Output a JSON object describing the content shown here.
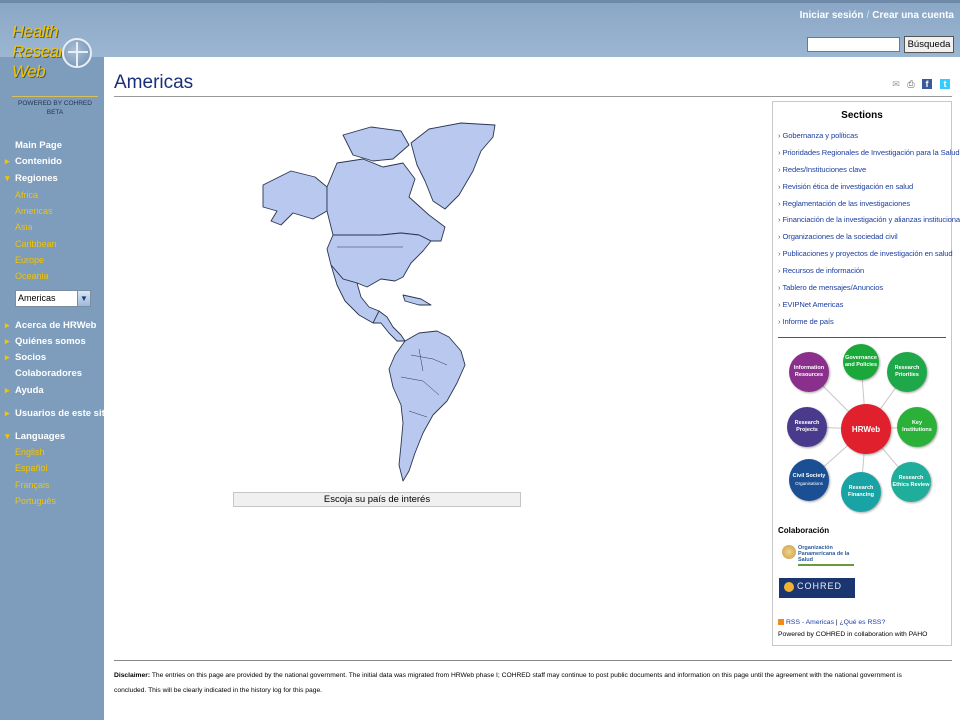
{
  "header": {
    "login_label": "Iniciar sesión",
    "separator": "/",
    "create_account_label": "Crear una cuenta",
    "search": {
      "placeholder": "",
      "button_label": "Búsqueda"
    }
  },
  "logo": {
    "line1": "Health",
    "line2": "Research",
    "line3": "Web",
    "powered": "POWERED BY COHRED",
    "beta": "BETA"
  },
  "sidebar": {
    "main_page": "Main Page",
    "contenido": "Contenido",
    "regiones": "Regiones",
    "regions": [
      "Africa",
      "Americas",
      "Asia",
      "Caribbean",
      "Europe",
      "Oceania"
    ],
    "region_select_value": "Americas",
    "acerca": "Acerca de HRWeb",
    "quienes": "Quiénes somos",
    "socios": "Socios",
    "colaboradores": "Colaboradores",
    "ayuda": "Ayuda",
    "usuarios": "Usuarios de este sitio",
    "languages_label": "Languages",
    "languages": [
      "English",
      "Español",
      "Français",
      "Português"
    ]
  },
  "main": {
    "title": "Americas",
    "country_select_label": "Escoja su país de interés"
  },
  "icons": [
    "email-icon",
    "print-icon",
    "facebook-icon",
    "twitter-icon"
  ],
  "sections": {
    "title": "Sections",
    "items": [
      "Gobernanza y políticas",
      "Prioridades Regionales de Investigación para la Salud",
      "Redes/Instituciones clave",
      "Revisión ética de investigación en salud",
      "Reglamentación de las investigaciones",
      "Financiación de la investigación y alianzas institucionales",
      "Organizaciones de la sociedad civil",
      "Publicaciones y proyectos de investigación en salud",
      "Recursos de información",
      "Tablero de mensajes/Anuncios",
      "EVIPNet Americas",
      "Informe de país"
    ]
  },
  "diagram": {
    "center": "HRWeb",
    "information_resources": "Information Resources",
    "governance": "Governance and Policies",
    "research_priorities": "Research Priorities",
    "research_projects": "Research Projects",
    "key_institutions": "Key Institutions",
    "civil_society": "Civil Society",
    "civil_society_sub": "Organisations",
    "research_financing": "Research Financing",
    "research_ethics": "Research Ethics Review"
  },
  "collaboration": {
    "title": "Colaboración",
    "paho_name": "Organización Panamericana de la Salud",
    "cohred_name": "COHRED"
  },
  "rss": {
    "link_label": "RSS - Americas",
    "separator": "|",
    "what_is": "¿Qué es RSS?",
    "powered_by": "Powered by COHRED in collaboration with PAHO"
  },
  "footer": {
    "disclaimer_label": "Disclaimer:",
    "disclaimer_text": "The entries on this page are provided by the national government. The initial data was migrated from HRWeb phase I; COHRED staff may continue to post public documents and information on this page until the agreement with the national government is concluded. This will be clearly indicated in the history log for this page."
  },
  "colors": {
    "header_bg": "#9cb6d2",
    "sidebar_bg": "#7e9cbb",
    "accent_yellow": "#f2c400",
    "title_blue": "#1a2f7a",
    "map_fill": "#b8c8ee"
  }
}
